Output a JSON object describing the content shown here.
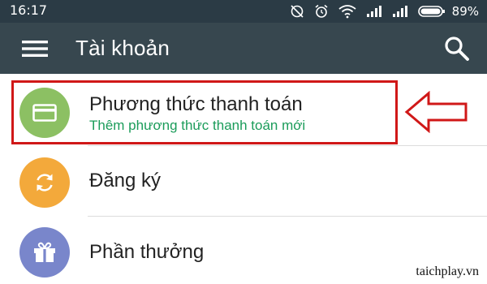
{
  "status_bar": {
    "time": "16:17",
    "battery_percent": "89%",
    "icons": [
      "data-saver-off-icon",
      "alarm-icon",
      "wifi-icon",
      "cell-signal-icon",
      "cell-signal-icon",
      "battery-icon"
    ]
  },
  "toolbar": {
    "title": "Tài khoản",
    "menu_icon": "menu-icon",
    "search_icon": "search-icon",
    "background": "#37474f"
  },
  "list": {
    "items": [
      {
        "label": "Phương thức thanh toán",
        "sublabel": "Thêm phương thức thanh toán mới",
        "icon": "credit-card-icon",
        "icon_color": "#8cc063"
      },
      {
        "label": "Đăng ký",
        "icon": "refresh-icon",
        "icon_color": "#f3a93b"
      },
      {
        "label": "Phần thưởng",
        "icon": "gift-icon",
        "icon_color": "#7986cb"
      }
    ]
  },
  "annotation": {
    "highlight_color": "#d01818",
    "arrow": "left-arrow-outline"
  },
  "watermark": "taichplay.vn"
}
